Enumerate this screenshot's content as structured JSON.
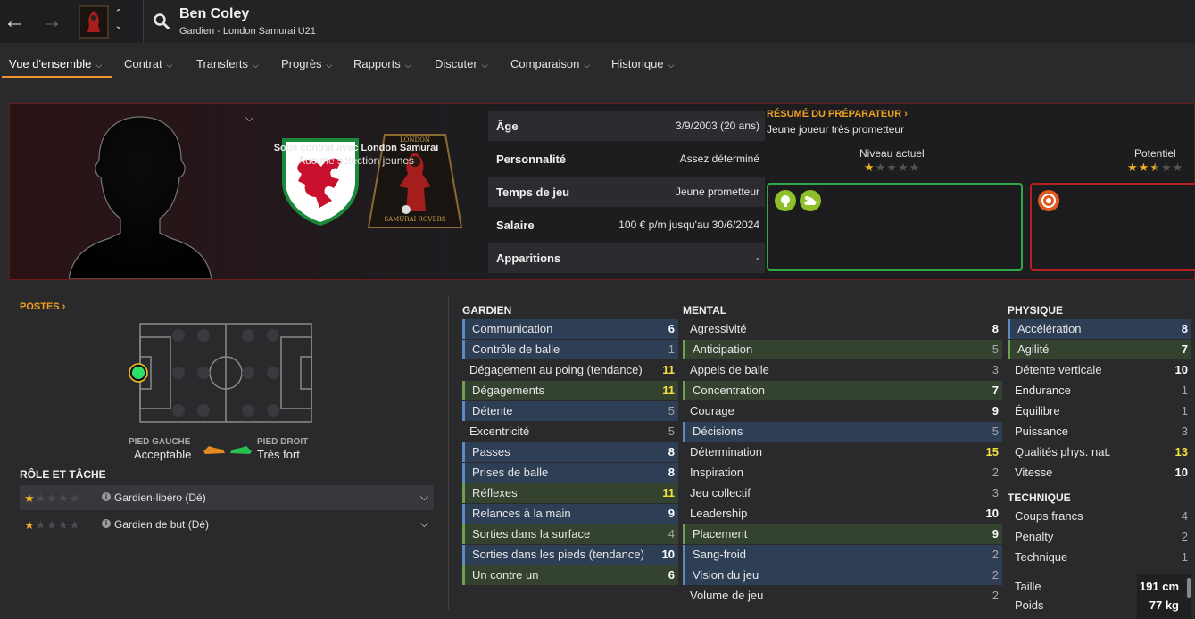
{
  "header": {
    "player_name": "Ben Coley",
    "player_subtitle": "Gardien - London Samurai U21"
  },
  "menu": [
    {
      "label": "Vue d'ensemble",
      "active": true
    },
    {
      "label": "Contrat"
    },
    {
      "label": "Transferts"
    },
    {
      "label": "Progrès"
    },
    {
      "label": "Rapports"
    },
    {
      "label": "Discuter"
    },
    {
      "label": "Comparaison"
    },
    {
      "label": "Historique"
    }
  ],
  "profile": {
    "contract_text": "Sous contrat avec London Samurai",
    "youth_text": "Aucune sélection jeunes",
    "crest_text_top": "LONDON",
    "crest_text_bottom": "SAMURAI ROVERS"
  },
  "info": [
    {
      "label": "Âge",
      "value": "3/9/2003 (20 ans)"
    },
    {
      "label": "Personnalité",
      "value": "Assez déterminé"
    },
    {
      "label": "Temps de jeu",
      "value": "Jeune prometteur"
    },
    {
      "label": "Salaire",
      "value": "100 € p/m jusqu'au 30/6/2024"
    },
    {
      "label": "Apparitions",
      "value": "-"
    }
  ],
  "coach_summary": {
    "title": "RÉSUMÉ DU PRÉPARATEUR",
    "text": "Jeune joueur très prometteur",
    "current_label": "Niveau actuel",
    "current_stars": 1,
    "potential_label": "Potentiel",
    "potential_stars": 2.5
  },
  "positions": {
    "title": "POSTES",
    "left_foot_label": "PIED GAUCHE",
    "left_foot_value": "Acceptable",
    "right_foot_label": "PIED DROIT",
    "right_foot_value": "Très fort"
  },
  "roles": {
    "title": "RÔLE ET TÂCHE",
    "items": [
      {
        "name": "Gardien-libéro (Dé)",
        "stars": 1
      },
      {
        "name": "Gardien de but (Dé)",
        "stars": 1
      }
    ]
  },
  "attributes": {
    "gardien": {
      "title": "GARDIEN",
      "items": [
        {
          "name": "Communication",
          "value": "6",
          "hl": "blue"
        },
        {
          "name": "Contrôle de balle",
          "value": "1",
          "hl": "blue"
        },
        {
          "name": "Dégagement au poing (tendance)",
          "value": "11",
          "hl": ""
        },
        {
          "name": "Dégagements",
          "value": "11",
          "hl": "green"
        },
        {
          "name": "Détente",
          "value": "5",
          "hl": "blue"
        },
        {
          "name": "Excentricité",
          "value": "5",
          "hl": ""
        },
        {
          "name": "Passes",
          "value": "8",
          "hl": "blue"
        },
        {
          "name": "Prises de balle",
          "value": "8",
          "hl": "blue"
        },
        {
          "name": "Réflexes",
          "value": "11",
          "hl": "green"
        },
        {
          "name": "Relances à la main",
          "value": "9",
          "hl": "blue"
        },
        {
          "name": "Sorties dans la surface",
          "value": "4",
          "hl": "green"
        },
        {
          "name": "Sorties dans les pieds (tendance)",
          "value": "10",
          "hl": "blue"
        },
        {
          "name": "Un contre un",
          "value": "6",
          "hl": "green"
        }
      ]
    },
    "mental": {
      "title": "MENTAL",
      "items": [
        {
          "name": "Agressivité",
          "value": "8",
          "hl": ""
        },
        {
          "name": "Anticipation",
          "value": "5",
          "hl": "green"
        },
        {
          "name": "Appels de balle",
          "value": "3",
          "hl": ""
        },
        {
          "name": "Concentration",
          "value": "7",
          "hl": "green"
        },
        {
          "name": "Courage",
          "value": "9",
          "hl": ""
        },
        {
          "name": "Décisions",
          "value": "5",
          "hl": "blue"
        },
        {
          "name": "Détermination",
          "value": "15",
          "hl": ""
        },
        {
          "name": "Inspiration",
          "value": "2",
          "hl": ""
        },
        {
          "name": "Jeu collectif",
          "value": "3",
          "hl": ""
        },
        {
          "name": "Leadership",
          "value": "10",
          "hl": ""
        },
        {
          "name": "Placement",
          "value": "9",
          "hl": "green"
        },
        {
          "name": "Sang-froid",
          "value": "2",
          "hl": "blue"
        },
        {
          "name": "Vision du jeu",
          "value": "2",
          "hl": "blue"
        },
        {
          "name": "Volume de jeu",
          "value": "2",
          "hl": ""
        }
      ]
    },
    "physique": {
      "title": "PHYSIQUE",
      "items": [
        {
          "name": "Accélération",
          "value": "8",
          "hl": "blue"
        },
        {
          "name": "Agilité",
          "value": "7",
          "hl": "green"
        },
        {
          "name": "Détente verticale",
          "value": "10",
          "hl": ""
        },
        {
          "name": "Endurance",
          "value": "1",
          "hl": ""
        },
        {
          "name": "Équilibre",
          "value": "1",
          "hl": ""
        },
        {
          "name": "Puissance",
          "value": "3",
          "hl": ""
        },
        {
          "name": "Qualités phys. nat.",
          "value": "13",
          "hl": ""
        },
        {
          "name": "Vitesse",
          "value": "10",
          "hl": ""
        }
      ]
    },
    "technique": {
      "title": "TECHNIQUE",
      "items": [
        {
          "name": "Coups francs",
          "value": "4",
          "hl": ""
        },
        {
          "name": "Penalty",
          "value": "2",
          "hl": ""
        },
        {
          "name": "Technique",
          "value": "1",
          "hl": ""
        }
      ]
    },
    "body": [
      {
        "name": "Taille",
        "value": "191 cm"
      },
      {
        "name": "Poids",
        "value": "77 kg"
      }
    ]
  }
}
